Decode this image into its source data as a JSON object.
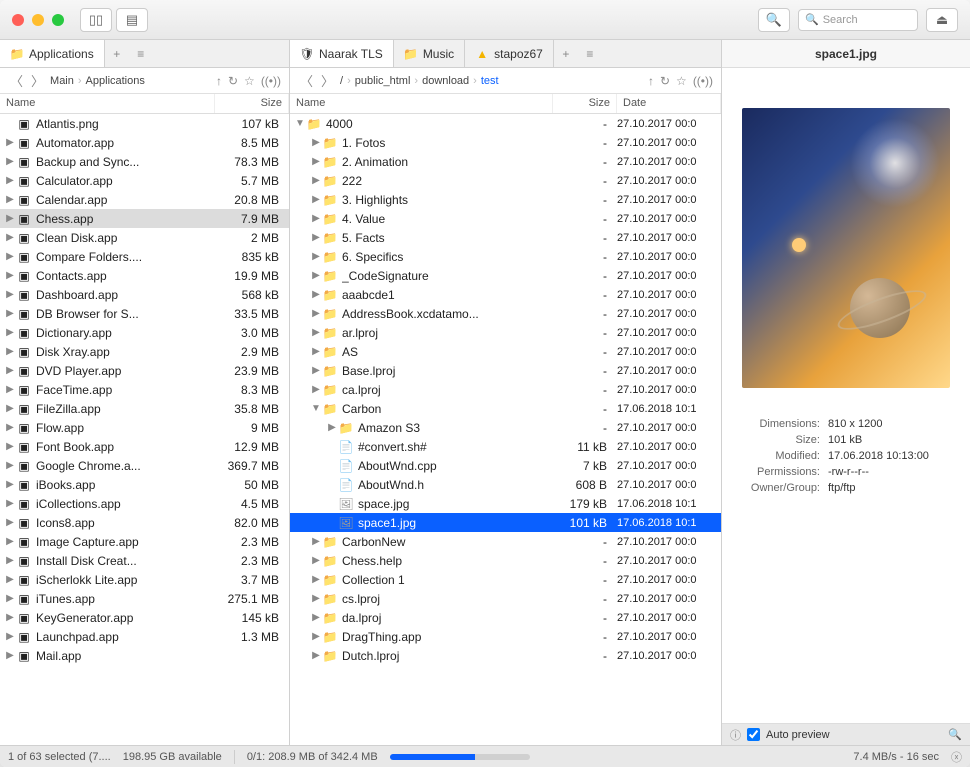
{
  "search_placeholder": "Search",
  "left": {
    "tab": {
      "label": "Applications",
      "icon": "folder-icon"
    },
    "breadcrumb": [
      "Main",
      "Applications"
    ],
    "headers": {
      "name": "Name",
      "size": "Size"
    },
    "files": [
      {
        "name": "Atlantis.png",
        "size": "107 kB",
        "icon": "png",
        "arrow": false
      },
      {
        "name": "Automator.app",
        "size": "8.5 MB",
        "icon": "app",
        "arrow": true
      },
      {
        "name": "Backup and Sync...",
        "size": "78.3 MB",
        "icon": "sync",
        "arrow": true
      },
      {
        "name": "Calculator.app",
        "size": "5.7 MB",
        "icon": "calc",
        "arrow": true
      },
      {
        "name": "Calendar.app",
        "size": "20.8 MB",
        "icon": "cal",
        "arrow": true
      },
      {
        "name": "Chess.app",
        "size": "7.9 MB",
        "icon": "chess",
        "arrow": true,
        "sel": "grey"
      },
      {
        "name": "Clean Disk.app",
        "size": "2 MB",
        "icon": "disk",
        "arrow": true
      },
      {
        "name": "Compare Folders....",
        "size": "835 kB",
        "icon": "cmp",
        "arrow": true
      },
      {
        "name": "Contacts.app",
        "size": "19.9 MB",
        "icon": "book",
        "arrow": true
      },
      {
        "name": "Dashboard.app",
        "size": "568 kB",
        "icon": "dash",
        "arrow": true
      },
      {
        "name": "DB Browser for S...",
        "size": "33.5 MB",
        "icon": "db",
        "arrow": true
      },
      {
        "name": "Dictionary.app",
        "size": "3.0 MB",
        "icon": "dict",
        "arrow": true
      },
      {
        "name": "Disk Xray.app",
        "size": "2.9 MB",
        "icon": "xray",
        "arrow": true
      },
      {
        "name": "DVD Player.app",
        "size": "23.9 MB",
        "icon": "dvd",
        "arrow": true
      },
      {
        "name": "FaceTime.app",
        "size": "8.3 MB",
        "icon": "ft",
        "arrow": true
      },
      {
        "name": "FileZilla.app",
        "size": "35.8 MB",
        "icon": "fz",
        "arrow": true
      },
      {
        "name": "Flow.app",
        "size": "9 MB",
        "icon": "flow",
        "arrow": true
      },
      {
        "name": "Font Book.app",
        "size": "12.9 MB",
        "icon": "font",
        "arrow": true
      },
      {
        "name": "Google Chrome.a...",
        "size": "369.7 MB",
        "icon": "chr",
        "arrow": true
      },
      {
        "name": "iBooks.app",
        "size": "50 MB",
        "icon": "ibk",
        "arrow": true
      },
      {
        "name": "iCollections.app",
        "size": "4.5 MB",
        "icon": "icol",
        "arrow": true
      },
      {
        "name": "Icons8.app",
        "size": "82.0 MB",
        "icon": "ic8",
        "arrow": true
      },
      {
        "name": "Image Capture.app",
        "size": "2.3 MB",
        "icon": "imgc",
        "arrow": true
      },
      {
        "name": "Install Disk Creat...",
        "size": "2.3 MB",
        "icon": "idc",
        "arrow": true
      },
      {
        "name": "iScherlokk Lite.app",
        "size": "3.7 MB",
        "icon": "isch",
        "arrow": true
      },
      {
        "name": "iTunes.app",
        "size": "275.1 MB",
        "icon": "itun",
        "arrow": true
      },
      {
        "name": "KeyGenerator.app",
        "size": "145 kB",
        "icon": "key",
        "arrow": true
      },
      {
        "name": "Launchpad.app",
        "size": "1.3 MB",
        "icon": "lpad",
        "arrow": true
      },
      {
        "name": "Mail.app",
        "size": "",
        "icon": "mail",
        "arrow": true
      }
    ],
    "status": {
      "selected": "1 of 63 selected (7....",
      "available": "198.95 GB available"
    }
  },
  "mid": {
    "tabs": [
      {
        "label": "Naarak TLS",
        "icon": "shield",
        "active": true
      },
      {
        "label": "Music",
        "icon": "folder"
      },
      {
        "label": "stapoz67",
        "icon": "gdrive"
      }
    ],
    "breadcrumb": [
      "/",
      "public_html",
      "download",
      "test"
    ],
    "headers": {
      "name": "Name",
      "size": "Size",
      "date": "Date"
    },
    "files": [
      {
        "name": "4000",
        "size": "-",
        "date": "27.10.2017 00:0",
        "folder": true,
        "indent": 0,
        "expand": "down"
      },
      {
        "name": "1. Fotos",
        "size": "-",
        "date": "27.10.2017 00:0",
        "folder": true,
        "indent": 1
      },
      {
        "name": "2. Animation",
        "size": "-",
        "date": "27.10.2017 00:0",
        "folder": true,
        "indent": 1
      },
      {
        "name": "222",
        "size": "-",
        "date": "27.10.2017 00:0",
        "folder": true,
        "indent": 1
      },
      {
        "name": "3. Highlights",
        "size": "-",
        "date": "27.10.2017 00:0",
        "folder": true,
        "indent": 1
      },
      {
        "name": "4. Value",
        "size": "-",
        "date": "27.10.2017 00:0",
        "folder": true,
        "indent": 1
      },
      {
        "name": "5. Facts",
        "size": "-",
        "date": "27.10.2017 00:0",
        "folder": true,
        "indent": 1
      },
      {
        "name": "6. Specifics",
        "size": "-",
        "date": "27.10.2017 00:0",
        "folder": true,
        "indent": 1
      },
      {
        "name": "_CodeSignature",
        "size": "-",
        "date": "27.10.2017 00:0",
        "folder": true,
        "indent": 1
      },
      {
        "name": "aaabcde1",
        "size": "-",
        "date": "27.10.2017 00:0",
        "folder": true,
        "indent": 1
      },
      {
        "name": "AddressBook.xcdatamo...",
        "size": "-",
        "date": "27.10.2017 00:0",
        "folder": true,
        "indent": 1
      },
      {
        "name": "ar.lproj",
        "size": "-",
        "date": "27.10.2017 00:0",
        "folder": true,
        "indent": 1
      },
      {
        "name": "AS",
        "size": "-",
        "date": "27.10.2017 00:0",
        "folder": true,
        "indent": 1
      },
      {
        "name": "Base.lproj",
        "size": "-",
        "date": "27.10.2017 00:0",
        "folder": true,
        "indent": 1
      },
      {
        "name": "ca.lproj",
        "size": "-",
        "date": "27.10.2017 00:0",
        "folder": true,
        "indent": 1
      },
      {
        "name": "Carbon",
        "size": "-",
        "date": "17.06.2018 10:1",
        "folder": true,
        "indent": 1,
        "expand": "down"
      },
      {
        "name": "Amazon S3",
        "size": "-",
        "date": "27.10.2017 00:0",
        "folder": true,
        "indent": 2
      },
      {
        "name": "#convert.sh#",
        "size": "11 kB",
        "date": "27.10.2017 00:0",
        "folder": false,
        "indent": 2,
        "icon": "txt"
      },
      {
        "name": "AboutWnd.cpp",
        "size": "7 kB",
        "date": "27.10.2017 00:0",
        "folder": false,
        "indent": 2,
        "icon": "cpp"
      },
      {
        "name": "AboutWnd.h",
        "size": "608 B",
        "date": "27.10.2017 00:0",
        "folder": false,
        "indent": 2,
        "icon": "h"
      },
      {
        "name": "space.jpg",
        "size": "179 kB",
        "date": "17.06.2018 10:1",
        "folder": false,
        "indent": 2,
        "icon": "jpg"
      },
      {
        "name": "space1.jpg",
        "size": "101 kB",
        "date": "17.06.2018 10:1",
        "folder": false,
        "indent": 2,
        "icon": "jpg",
        "sel": "blue"
      },
      {
        "name": "CarbonNew",
        "size": "-",
        "date": "27.10.2017 00:0",
        "folder": true,
        "indent": 1
      },
      {
        "name": "Chess.help",
        "size": "-",
        "date": "27.10.2017 00:0",
        "folder": true,
        "indent": 1
      },
      {
        "name": "Collection 1",
        "size": "-",
        "date": "27.10.2017 00:0",
        "folder": true,
        "indent": 1
      },
      {
        "name": "cs.lproj",
        "size": "-",
        "date": "27.10.2017 00:0",
        "folder": true,
        "indent": 1
      },
      {
        "name": "da.lproj",
        "size": "-",
        "date": "27.10.2017 00:0",
        "folder": true,
        "indent": 1
      },
      {
        "name": "DragThing.app",
        "size": "-",
        "date": "27.10.2017 00:0",
        "folder": true,
        "indent": 1
      },
      {
        "name": "Dutch.lproj",
        "size": "-",
        "date": "27.10.2017 00:0",
        "folder": true,
        "indent": 1
      }
    ],
    "status": {
      "progress": "0/1: 208.9 MB of 342.4 MB",
      "speed": "7.4 MB/s - 16 sec"
    }
  },
  "right": {
    "title": "space1.jpg",
    "meta": {
      "dimensions_label": "Dimensions:",
      "dimensions": "810 x 1200",
      "size_label": "Size:",
      "size": "101 kB",
      "modified_label": "Modified:",
      "modified": "17.06.2018 10:13:00",
      "permissions_label": "Permissions:",
      "permissions": "-rw-r--r--",
      "owner_label": "Owner/Group:",
      "owner": "ftp/ftp"
    },
    "auto_preview": "Auto preview"
  }
}
